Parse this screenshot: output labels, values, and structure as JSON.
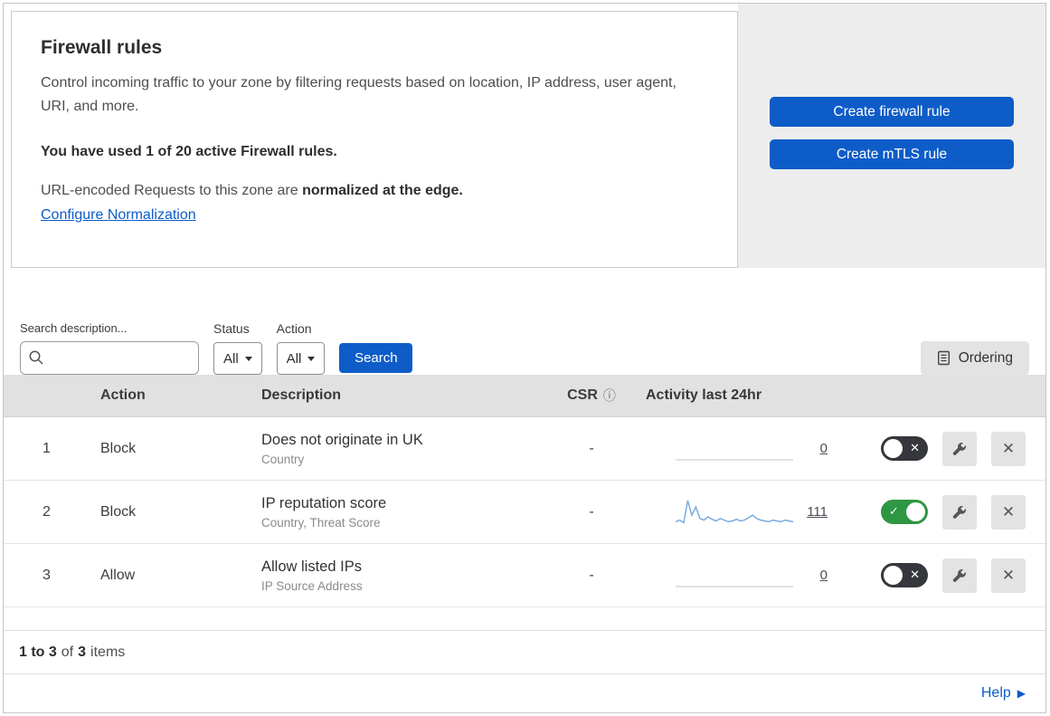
{
  "header": {
    "title": "Firewall rules",
    "description": "Control incoming traffic to your zone by filtering requests based on location, IP address, user agent, URI, and more.",
    "usage_text": "You have used 1 of 20 active Firewall rules.",
    "normalization_prefix": "URL-encoded Requests to this zone are",
    "normalization_bold": "normalized at the edge.",
    "normalization_link": "Configure Normalization",
    "create_firewall_button": "Create firewall rule",
    "create_mtls_button": "Create mTLS rule"
  },
  "filters": {
    "search_label": "Search description...",
    "status_label": "Status",
    "status_value": "All",
    "action_label": "Action",
    "action_value": "All",
    "search_button": "Search",
    "ordering_button": "Ordering"
  },
  "table": {
    "headers": {
      "action": "Action",
      "description": "Description",
      "csr": "CSR",
      "activity": "Activity last 24hr"
    },
    "rows": [
      {
        "num": "1",
        "action": "Block",
        "title": "Does not originate in UK",
        "subtitle": "Country",
        "csr": "-",
        "count": "0",
        "enabled": false,
        "sparkline": []
      },
      {
        "num": "2",
        "action": "Block",
        "title": "IP reputation score",
        "subtitle": "Country, Threat Score",
        "csr": "-",
        "count": "111",
        "enabled": true,
        "sparkline": [
          4,
          6,
          3,
          30,
          12,
          22,
          8,
          6,
          10,
          7,
          5,
          8,
          6,
          4,
          5,
          7,
          5,
          6,
          9,
          12,
          8,
          6,
          5,
          4,
          6,
          5,
          4,
          6,
          5,
          4
        ]
      },
      {
        "num": "3",
        "action": "Allow",
        "title": "Allow listed IPs",
        "subtitle": "IP Source Address",
        "csr": "-",
        "count": "0",
        "enabled": false,
        "sparkline": []
      }
    ]
  },
  "footer": {
    "range": "1 to 3",
    "of": "of",
    "total": "3",
    "items": "items",
    "help": "Help"
  },
  "icons": {
    "info": "ⓘ",
    "help_arrow": "▶",
    "toggle_on": "✓",
    "toggle_off": "✕",
    "close": "✕"
  },
  "colors": {
    "accent_blue": "#0d5cc8",
    "toggle_green": "#2f9643"
  }
}
